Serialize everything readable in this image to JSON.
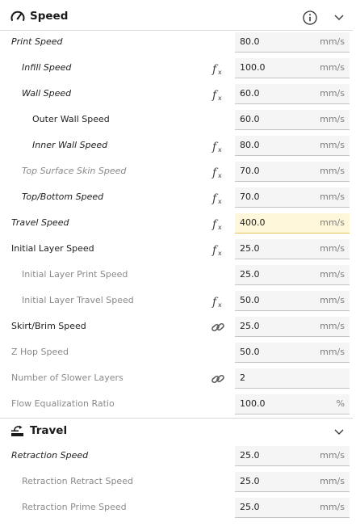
{
  "speed": {
    "title": "Speed",
    "rows": [
      {
        "label": "Print Speed",
        "value": "80.0",
        "unit": "mm/s"
      },
      {
        "label": "Infill Speed",
        "value": "100.0",
        "unit": "mm/s"
      },
      {
        "label": "Wall Speed",
        "value": "60.0",
        "unit": "mm/s"
      },
      {
        "label": "Outer Wall Speed",
        "value": "60.0",
        "unit": "mm/s"
      },
      {
        "label": "Inner Wall Speed",
        "value": "80.0",
        "unit": "mm/s"
      },
      {
        "label": "Top Surface Skin Speed",
        "value": "70.0",
        "unit": "mm/s"
      },
      {
        "label": "Top/Bottom Speed",
        "value": "70.0",
        "unit": "mm/s"
      },
      {
        "label": "Travel Speed",
        "value": "400.0",
        "unit": "mm/s"
      },
      {
        "label": "Initial Layer Speed",
        "value": "25.0",
        "unit": "mm/s"
      },
      {
        "label": "Initial Layer Print Speed",
        "value": "25.0",
        "unit": "mm/s"
      },
      {
        "label": "Initial Layer Travel Speed",
        "value": "50.0",
        "unit": "mm/s"
      },
      {
        "label": "Skirt/Brim Speed",
        "value": "25.0",
        "unit": "mm/s"
      },
      {
        "label": "Z Hop Speed",
        "value": "50.0",
        "unit": "mm/s"
      },
      {
        "label": "Number of Slower Layers",
        "value": "2",
        "unit": ""
      },
      {
        "label": "Flow Equalization Ratio",
        "value": "100.0",
        "unit": "%"
      }
    ]
  },
  "travel": {
    "title": "Travel",
    "rows": [
      {
        "label": "Retraction Speed",
        "value": "25.0",
        "unit": "mm/s"
      },
      {
        "label": "Retraction Retract Speed",
        "value": "25.0",
        "unit": "mm/s"
      },
      {
        "label": "Retraction Prime Speed",
        "value": "25.0",
        "unit": "mm/s"
      }
    ]
  },
  "icons": {
    "speed_section": "speedometer-icon",
    "travel_section": "travel-icon",
    "info": "info-icon",
    "collapse": "chevron-down-icon",
    "function": "function-icon",
    "link": "link-icon"
  },
  "colors": {
    "highlight_field": "#fff7d9",
    "muted_text": "#8a8a8a",
    "field_bg": "#f5f5f5"
  }
}
